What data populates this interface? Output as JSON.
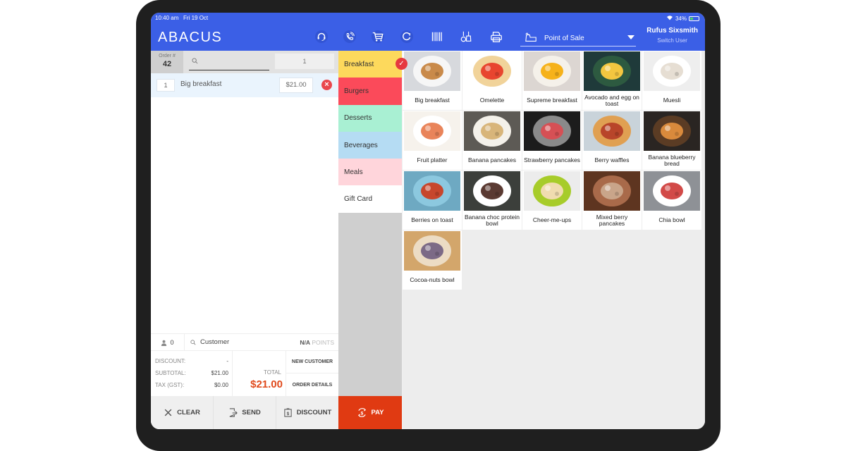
{
  "status_bar": {
    "time": "10:40 am",
    "date": "Fri 19 Oct",
    "battery": "34%",
    "battery_level": 0.34
  },
  "header": {
    "logo": "ABACUS",
    "toolbar_icons": [
      "headset-icon",
      "phone-icon",
      "cart-icon",
      "refresh-icon",
      "barcode-icon",
      "kitchen-tools-icon",
      "printer-icon"
    ],
    "mode_select": {
      "selected": "Point of Sale",
      "icon": "register-icon"
    },
    "user": {
      "name": "Rufus Sixsmith",
      "switch_label": "Switch User"
    }
  },
  "order": {
    "number_label": "Order #",
    "number": "42",
    "search_placeholder": "",
    "quantity": "1",
    "lines": [
      {
        "qty": "1",
        "name": "Big breakfast",
        "price": "$21.00"
      }
    ],
    "customer": {
      "count": "0",
      "search_label": "Customer",
      "points_value": "N/A",
      "points_label": "POINTS"
    },
    "totals": {
      "discount_label": "DISCOUNT:",
      "discount_value": "-",
      "subtotal_label": "SUBTOTAL:",
      "subtotal_value": "$21.00",
      "tax_label": "TAX (GST):",
      "tax_value": "$0.00",
      "total_label": "TOTAL",
      "total_value": "$21.00"
    },
    "actions": {
      "new_customer": "NEW CUSTOMER",
      "order_details": "ORDER DETAILS"
    },
    "buttons": {
      "clear": "CLEAR",
      "send": "SEND",
      "discount": "DISCOUNT",
      "pay": "PAY"
    }
  },
  "categories": [
    {
      "label": "Breakfast",
      "color": "#fdd95c",
      "selected": true
    },
    {
      "label": "Burgers",
      "color": "#fb4a5a",
      "selected": false
    },
    {
      "label": "Desserts",
      "color": "#a9f0d3",
      "selected": false
    },
    {
      "label": "Beverages",
      "color": "#b5dcf3",
      "selected": false
    },
    {
      "label": "Meals",
      "color": "#ffd5db",
      "selected": false
    },
    {
      "label": "Gift Card",
      "color": "#ffffff",
      "selected": false
    }
  ],
  "products": [
    {
      "name": "Big breakfast",
      "bg": "#d7d9dd",
      "plate": "#f6f6f6",
      "food": "#c98a4a"
    },
    {
      "name": "Omelette",
      "bg": "#ffffff",
      "plate": "#f1d39a",
      "food": "#e8452f"
    },
    {
      "name": "Supreme breakfast",
      "bg": "#dcd6d2",
      "plate": "#f5f1ea",
      "food": "#f6b21a"
    },
    {
      "name": "Avocado and egg on toast",
      "bg": "#1f3a3a",
      "plate": "#2d5a40",
      "food": "#f3c640"
    },
    {
      "name": "Muesli",
      "bg": "#eeeeee",
      "plate": "#ffffff",
      "food": "#e6ded3"
    },
    {
      "name": "Fruit platter",
      "bg": "#f6f2ec",
      "plate": "#ffffff",
      "food": "#e9845a"
    },
    {
      "name": "Banana pancakes",
      "bg": "#5d5a55",
      "plate": "#f4f1ea",
      "food": "#d8b57a"
    },
    {
      "name": "Strawberry pancakes",
      "bg": "#1c1c1c",
      "plate": "#8a8a8a",
      "food": "#d65055"
    },
    {
      "name": "Berry waffles",
      "bg": "#c9d3da",
      "plate": "#e0a052",
      "food": "#b8452a"
    },
    {
      "name": "Banana blueberry bread",
      "bg": "#2a2522",
      "plate": "#5b3c24",
      "food": "#d98a3c"
    },
    {
      "name": "Berries on toast",
      "bg": "#6ea9c2",
      "plate": "#8cc8df",
      "food": "#c7462c"
    },
    {
      "name": "Banana choc protein bowl",
      "bg": "#3c3f3b",
      "plate": "#ffffff",
      "food": "#5a3a32"
    },
    {
      "name": "Cheer-me-ups",
      "bg": "#ececec",
      "plate": "#a7cc2a",
      "food": "#f0dcb0"
    },
    {
      "name": "Mixed berry pancakes",
      "bg": "#5e3520",
      "plate": "#a96a4a",
      "food": "#c9a58a"
    },
    {
      "name": "Chia bowl",
      "bg": "#8e9196",
      "plate": "#ffffff",
      "food": "#d24a48"
    },
    {
      "name": "Cocoa-nuts bowl",
      "bg": "#d3a66b",
      "plate": "#ecdcc4",
      "food": "#7c6a86"
    }
  ]
}
